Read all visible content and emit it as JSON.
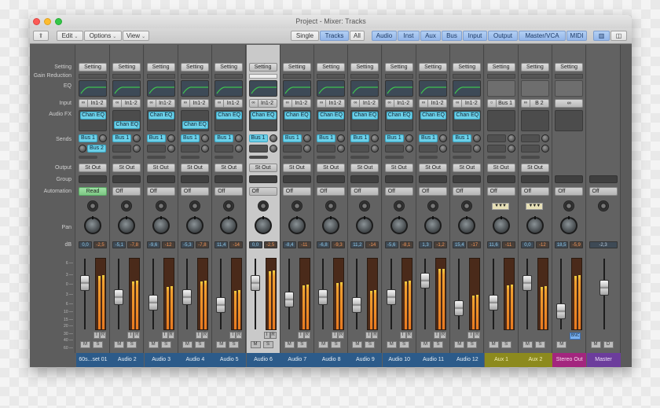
{
  "window": {
    "title": "Project - Mixer: Tracks"
  },
  "toolbar": {
    "back_icon": "up-arrow-icon",
    "menus": [
      "Edit",
      "Options",
      "View"
    ],
    "view_modes": [
      {
        "label": "Single",
        "selected": false
      },
      {
        "label": "Tracks",
        "selected": true
      },
      {
        "label": "All",
        "selected": false
      }
    ],
    "filters": [
      {
        "label": "Audio",
        "selected": true
      },
      {
        "label": "Inst",
        "selected": true
      },
      {
        "label": "Aux",
        "selected": true
      },
      {
        "label": "Bus",
        "selected": true
      },
      {
        "label": "Input",
        "selected": true
      },
      {
        "label": "Output",
        "selected": true
      },
      {
        "label": "Master/VCA",
        "selected": true
      },
      {
        "label": "MIDI",
        "selected": true
      }
    ],
    "layout_buttons": [
      {
        "icon": "wide-strip-icon",
        "selected": true
      },
      {
        "icon": "narrow-strip-icon",
        "selected": false
      }
    ]
  },
  "row_labels": {
    "setting": "Setting",
    "gain_reduction": "Gain Reduction",
    "eq": "EQ",
    "input": "Input",
    "audio_fx": "Audio FX",
    "sends": "Sends",
    "output": "Output",
    "group": "Group",
    "automation": "Automation",
    "pan": "Pan",
    "db": "dB"
  },
  "db_scale": [
    "6",
    "3",
    "0",
    "3",
    "6",
    "10",
    "15",
    "20",
    "30",
    "40",
    "60"
  ],
  "strips": [
    {
      "name": "60s...set 01",
      "type": "audio",
      "setting": "Setting",
      "eq": true,
      "input": "In1-2",
      "input_icon": "stereo-link-icon",
      "fx": [
        {
          "label": "Chan EQ",
          "slot": 0
        }
      ],
      "sends": [
        {
          "label": "Bus 1",
          "slot": 0
        },
        {
          "label": "Bus 2",
          "slot": 1
        }
      ],
      "output": "St Out",
      "automation": "Read",
      "volume": "0,0",
      "peak": "-2,5",
      "fader": 0.7,
      "meter": [
        0.76,
        0.77
      ],
      "ir": true,
      "mute": "M",
      "solo": "S",
      "selected": false
    },
    {
      "name": "Audio 2",
      "type": "audio",
      "setting": "Setting",
      "eq": true,
      "input": "In1-2",
      "input_icon": "stereo-link-icon",
      "fx": [
        {
          "label": "Chan EQ",
          "slot": 1
        }
      ],
      "sends": [
        {
          "label": "Bus 1",
          "slot": 0
        }
      ],
      "output": "St Out",
      "automation": "Off",
      "volume": "-5,1",
      "peak": "-7,8",
      "fader": 0.45,
      "meter": [
        0.68,
        0.69
      ],
      "ir": true,
      "mute": "M",
      "solo": "S",
      "selected": false
    },
    {
      "name": "Audio 3",
      "type": "audio",
      "setting": "Setting",
      "eq": true,
      "input": "In1-2",
      "input_icon": "stereo-link-icon",
      "fx": [
        {
          "label": "Chan EQ",
          "slot": 0
        }
      ],
      "sends": [
        {
          "label": "Bus 1",
          "slot": 0
        }
      ],
      "output": "St Out",
      "automation": "Off",
      "volume": "-9,6",
      "peak": "-12",
      "fader": 0.35,
      "meter": [
        0.6,
        0.61
      ],
      "ir": true,
      "mute": "M",
      "solo": "S",
      "selected": false
    },
    {
      "name": "Audio 4",
      "type": "audio",
      "setting": "Setting",
      "eq": true,
      "input": "In1-2",
      "input_icon": "stereo-link-icon",
      "fx": [
        {
          "label": "Chan EQ",
          "slot": 1
        }
      ],
      "sends": [
        {
          "label": "Bus 1",
          "slot": 0
        }
      ],
      "output": "St Out",
      "automation": "Off",
      "volume": "-5,3",
      "peak": "-7,8",
      "fader": 0.45,
      "meter": [
        0.68,
        0.69
      ],
      "ir": true,
      "mute": "M",
      "solo": "S",
      "selected": false
    },
    {
      "name": "Audio 5",
      "type": "audio",
      "setting": "Setting",
      "eq": true,
      "input": "In1-2",
      "input_icon": "stereo-link-icon",
      "fx": [
        {
          "label": "Chan EQ",
          "slot": 0
        }
      ],
      "sends": [
        {
          "label": "Bus 1",
          "slot": 0
        }
      ],
      "output": "St Out",
      "automation": "Off",
      "volume": "11,4",
      "peak": "-14",
      "fader": 0.3,
      "meter": [
        0.55,
        0.56
      ],
      "ir": true,
      "mute": "M",
      "solo": "S",
      "selected": false
    },
    {
      "name": "Audio 6",
      "type": "audio",
      "setting": "Setting",
      "eq": true,
      "input": "In1-2",
      "input_icon": "stereo-link-icon",
      "fx": [
        {
          "label": "Chan EQ",
          "slot": 0
        }
      ],
      "sends": [
        {
          "label": "Bus 1",
          "slot": 0
        }
      ],
      "output": "St Out",
      "automation": "Off",
      "volume": "0,0",
      "peak": "-2,5",
      "fader": 0.7,
      "meter": [
        0.82,
        0.83
      ],
      "ir": true,
      "mute": "M",
      "solo": "S",
      "selected": true
    },
    {
      "name": "Audio 7",
      "type": "audio",
      "setting": "Setting",
      "eq": true,
      "input": "In1-2",
      "input_icon": "stereo-link-icon",
      "fx": [
        {
          "label": "Chan EQ",
          "slot": 0
        }
      ],
      "sends": [
        {
          "label": "Bus 1",
          "slot": 0
        }
      ],
      "output": "St Out",
      "automation": "Off",
      "volume": "-8,4",
      "peak": "-11",
      "fader": 0.4,
      "meter": [
        0.62,
        0.63
      ],
      "ir": true,
      "mute": "M",
      "solo": "S",
      "selected": false
    },
    {
      "name": "Audio 8",
      "type": "audio",
      "setting": "Setting",
      "eq": true,
      "input": "In1-2",
      "input_icon": "stereo-link-icon",
      "fx": [
        {
          "label": "Chan EQ",
          "slot": 0
        }
      ],
      "sends": [
        {
          "label": "Bus 1",
          "slot": 0
        }
      ],
      "output": "St Out",
      "automation": "Off",
      "volume": "-6,8",
      "peak": "-9,3",
      "fader": 0.45,
      "meter": [
        0.66,
        0.67
      ],
      "ir": true,
      "mute": "M",
      "solo": "S",
      "selected": false
    },
    {
      "name": "Audio 9",
      "type": "audio",
      "setting": "Setting",
      "eq": true,
      "input": "In1-2",
      "input_icon": "stereo-link-icon",
      "fx": [
        {
          "label": "Chan EQ",
          "slot": 0
        }
      ],
      "sends": [
        {
          "label": "Bus 1",
          "slot": 0
        }
      ],
      "output": "St Out",
      "automation": "Off",
      "volume": "11,2",
      "peak": "-14",
      "fader": 0.3,
      "meter": [
        0.55,
        0.56
      ],
      "ir": true,
      "mute": "M",
      "solo": "S",
      "selected": false
    },
    {
      "name": "Audio 10",
      "type": "audio",
      "setting": "Setting",
      "eq": true,
      "input": "In1-2",
      "input_icon": "stereo-link-icon",
      "fx": [
        {
          "label": "Chan EQ",
          "slot": 0
        }
      ],
      "sends": [
        {
          "label": "Bus 1",
          "slot": 0
        }
      ],
      "output": "St Out",
      "automation": "Off",
      "volume": "-5,6",
      "peak": "-8,1",
      "fader": 0.45,
      "meter": [
        0.68,
        0.69
      ],
      "ir": true,
      "mute": "M",
      "solo": "S",
      "selected": false
    },
    {
      "name": "Audio 11",
      "type": "audio",
      "setting": "Setting",
      "eq": true,
      "input": "In1-2",
      "input_icon": "stereo-link-icon",
      "fx": [
        {
          "label": "Chan EQ",
          "slot": 0
        }
      ],
      "sends": [
        {
          "label": "Bus 1",
          "slot": 0
        }
      ],
      "output": "St Out",
      "automation": "Off",
      "volume": "1,3",
      "peak": "-1,2",
      "fader": 0.75,
      "meter": [
        0.86,
        0.86
      ],
      "ir": true,
      "mute": "M",
      "solo": "S",
      "selected": false
    },
    {
      "name": "Audio 12",
      "type": "audio",
      "setting": "Setting",
      "eq": true,
      "input": "In1-2",
      "input_icon": "stereo-link-icon",
      "fx": [
        {
          "label": "Chan EQ",
          "slot": 0
        }
      ],
      "sends": [
        {
          "label": "Bus 1",
          "slot": 0
        }
      ],
      "output": "St Out",
      "automation": "Off",
      "volume": "15,4",
      "peak": "-17",
      "fader": 0.25,
      "meter": [
        0.48,
        0.49
      ],
      "ir": true,
      "mute": "M",
      "solo": "S",
      "selected": false
    },
    {
      "name": "Aux 1",
      "type": "aux",
      "setting": "Setting",
      "eq": false,
      "input": "Bus 1",
      "input_icon": "mono-icon",
      "fx": [],
      "sends": [],
      "output": "St Out",
      "automation": "Off",
      "volume": "11,6",
      "peak": "-11",
      "fader": 0.35,
      "meter": [
        0.62,
        0.63
      ],
      "ir": false,
      "mute": "M",
      "solo": "S",
      "selected": false
    },
    {
      "name": "Aux 2",
      "type": "aux",
      "setting": "Setting",
      "eq": false,
      "input": "B 2",
      "input_icon": "stereo-link-icon",
      "fx": [],
      "sends": [],
      "output": "St Out",
      "automation": "Off",
      "volume": "0,0",
      "peak": "-12",
      "fader": 0.7,
      "meter": [
        0.6,
        0.61
      ],
      "ir": false,
      "mute": "M",
      "solo": "S",
      "selected": false
    },
    {
      "name": "Stereo Out",
      "type": "stout",
      "setting": "Setting",
      "eq": false,
      "input": "",
      "input_icon": "stereo-link-icon",
      "fx": [],
      "sends": null,
      "output": "",
      "automation": "Off",
      "volume": "18,5",
      "peak": "-5,9",
      "fader": 0.18,
      "meter": [
        0.76,
        0.77
      ],
      "ir": false,
      "bnc": "BNC",
      "mute": "M",
      "solo": "",
      "selected": false
    },
    {
      "name": "Master",
      "type": "master",
      "setting": "",
      "eq": null,
      "input": null,
      "input_icon": null,
      "fx": null,
      "sends": null,
      "output": "",
      "automation": "Off",
      "volume": "-2,3",
      "peak": "",
      "fader": 0.62,
      "meter": null,
      "ir": false,
      "mute": "M",
      "solo": "D",
      "selected": false
    }
  ]
}
